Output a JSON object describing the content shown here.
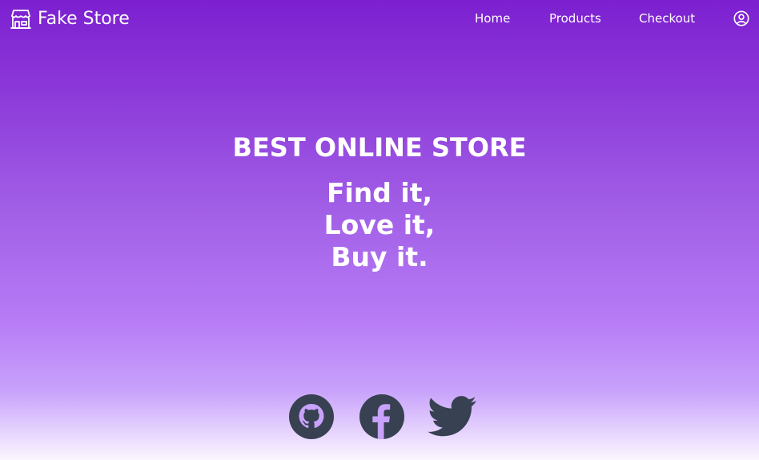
{
  "nav": {
    "brand": "Fake Store",
    "links": [
      "Home",
      "Products",
      "Checkout"
    ]
  },
  "hero": {
    "kicker": "BEST ONLINE STORE",
    "lines": [
      "Find it,",
      "Love it,",
      "Buy it."
    ]
  },
  "social": {
    "icons": [
      "github-icon",
      "facebook-icon",
      "twitter-icon"
    ]
  },
  "colors": {
    "gradient_top": "#7c20d0",
    "gradient_mid": "#b77cf6",
    "gradient_bottom": "#fbf6ff",
    "icon_dark": "#374151",
    "text": "#ffffff"
  }
}
